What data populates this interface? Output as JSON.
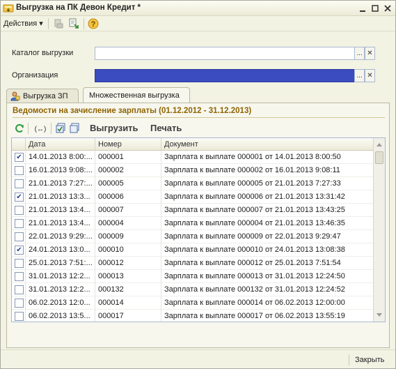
{
  "window": {
    "title": "Выгрузка на ПК Девон Кредит *"
  },
  "toolbar": {
    "actions_label": "Действия",
    "actions_arrow": "▾"
  },
  "fields": {
    "catalog_label": "Каталог выгрузки",
    "catalog_value": "",
    "org_label": "Организация",
    "org_value": "",
    "dots": "...",
    "clear": "✕"
  },
  "tabs": [
    {
      "label": "Выгрузка ЗП",
      "active": false
    },
    {
      "label": "Множественная выгрузка",
      "active": true
    }
  ],
  "section": {
    "title": "Ведомости на зачисление зарплаты (01.12.2012 - 31.12.2013)"
  },
  "subtoolbar": {
    "export_label": "Выгрузить",
    "print_label": "Печать"
  },
  "table": {
    "columns": [
      "Дата",
      "Номер",
      "Документ"
    ],
    "rows": [
      {
        "checked": true,
        "date": "14.01.2013 8:00:...",
        "number": "000001",
        "doc": "Зарплата к выплате 000001 от 14.01.2013 8:00:50"
      },
      {
        "checked": false,
        "date": "16.01.2013 9:08:...",
        "number": "000002",
        "doc": "Зарплата к выплате 000002 от 16.01.2013 9:08:11"
      },
      {
        "checked": false,
        "date": "21.01.2013 7:27:...",
        "number": "000005",
        "doc": "Зарплата к выплате 000005 от 21.01.2013 7:27:33"
      },
      {
        "checked": true,
        "date": "21.01.2013 13:3...",
        "number": "000006",
        "doc": "Зарплата к выплате 000006 от 21.01.2013 13:31:42"
      },
      {
        "checked": false,
        "date": "21.01.2013 13:4...",
        "number": "000007",
        "doc": "Зарплата к выплате 000007 от 21.01.2013 13:43:25"
      },
      {
        "checked": false,
        "date": "21.01.2013 13:4...",
        "number": "000004",
        "doc": "Зарплата к выплате 000004 от 21.01.2013 13:46:35"
      },
      {
        "checked": false,
        "date": "22.01.2013 9:29:...",
        "number": "000009",
        "doc": "Зарплата к выплате 000009 от 22.01.2013 9:29:47"
      },
      {
        "checked": true,
        "date": "24.01.2013 13:0...",
        "number": "000010",
        "doc": "Зарплата к выплате 000010 от 24.01.2013 13:08:38"
      },
      {
        "checked": false,
        "date": "25.01.2013 7:51:...",
        "number": "000012",
        "doc": "Зарплата к выплате 000012 от 25.01.2013 7:51:54"
      },
      {
        "checked": false,
        "date": "31.01.2013 12:2...",
        "number": "000013",
        "doc": "Зарплата к выплате 000013 от 31.01.2013 12:24:50"
      },
      {
        "checked": false,
        "date": "31.01.2013 12:2...",
        "number": "000132",
        "doc": "Зарплата к выплате 000132 от 31.01.2013 12:24:52"
      },
      {
        "checked": false,
        "date": "06.02.2013 12:0...",
        "number": "000014",
        "doc": "Зарплата к выплате 000014 от 06.02.2013 12:00:00"
      },
      {
        "checked": false,
        "date": "06.02.2013 13:5...",
        "number": "000017",
        "doc": "Зарплата к выплате 000017 от 06.02.2013 13:55:19"
      }
    ]
  },
  "footer": {
    "close_label": "Закрыть"
  },
  "colors": {
    "accent": "#8f6400",
    "selection": "#3b4cc0",
    "check": "#1a3f9c"
  }
}
